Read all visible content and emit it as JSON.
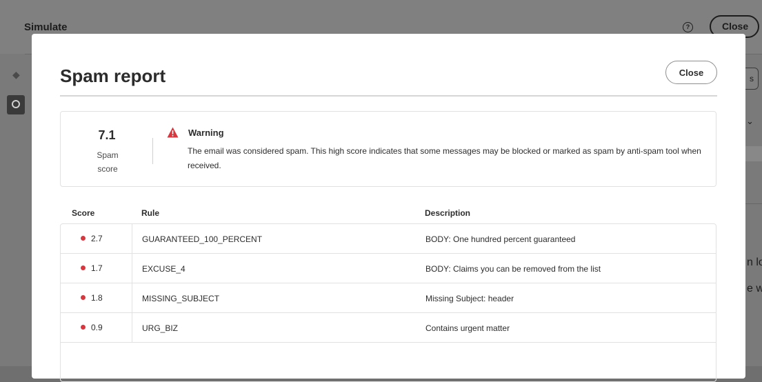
{
  "background": {
    "title": "Simulate",
    "close_label": "Close",
    "help_icon": "help-circle-icon",
    "right_pill_text": "s",
    "right_text_1": "n lo",
    "right_text_2": "e w"
  },
  "modal": {
    "title": "Spam report",
    "close_label": "Close"
  },
  "summary": {
    "score": "7.1",
    "score_label": "Spam score",
    "warning_title": "Warning",
    "warning_text": "The email was considered spam. This high score indicates that some messages may be blocked or marked as spam by anti-spam tool when received.",
    "warning_color": "#d7373f"
  },
  "table": {
    "headers": {
      "score": "Score",
      "rule": "Rule",
      "description": "Description"
    },
    "rows": [
      {
        "score": "2.7",
        "rule": "GUARANTEED_100_PERCENT",
        "description": "BODY: One hundred percent guaranteed"
      },
      {
        "score": "1.7",
        "rule": "EXCUSE_4",
        "description": "BODY: Claims you can be removed from the list"
      },
      {
        "score": "1.8",
        "rule": "MISSING_SUBJECT",
        "description": "Missing Subject: header"
      },
      {
        "score": "0.9",
        "rule": "URG_BIZ",
        "description": "Contains urgent matter"
      }
    ]
  }
}
